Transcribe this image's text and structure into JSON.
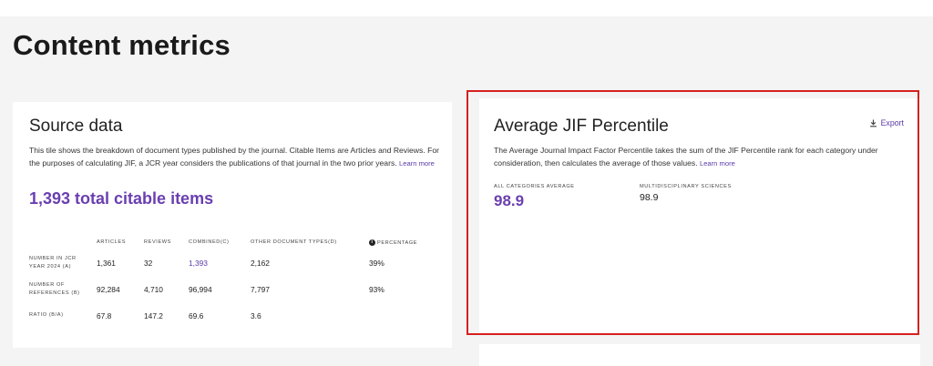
{
  "page": {
    "title": "Content metrics"
  },
  "source_data": {
    "title": "Source data",
    "description": "This tile shows the breakdown of document types published by the journal. Citable Items are Articles and Reviews. For the purposes of calculating JIF, a JCR year considers the publications of that journal in the two prior years.",
    "learn_more": "Learn more",
    "total_citable": "1,393 total citable items",
    "columns": [
      "ARTICLES",
      "REVIEWS",
      "COMBINED(C)",
      "OTHER DOCUMENT TYPES(D)",
      "PERCENTAGE"
    ],
    "percentage_info_icon": "info-icon",
    "rows": [
      {
        "label_line1": "NUMBER IN JCR",
        "label_line2": "YEAR 2024 (A)",
        "articles": "1,361",
        "reviews": "32",
        "combined": "1,393",
        "other": "2,162",
        "percentage": "39%"
      },
      {
        "label_line1": "NUMBER OF",
        "label_line2": "REFERENCES (B)",
        "articles": "92,284",
        "reviews": "4,710",
        "combined": "96,994",
        "other": "7,797",
        "percentage": "93%"
      },
      {
        "label_line1": "RATIO (B/A)",
        "label_line2": "",
        "articles": "67.8",
        "reviews": "147.2",
        "combined": "69.6",
        "other": "3.6",
        "percentage": ""
      }
    ]
  },
  "jif_percentile": {
    "title": "Average JIF Percentile",
    "export_label": "Export",
    "export_icon": "download-icon",
    "description": "The Average Journal Impact Factor Percentile takes the sum of the JIF Percentile rank for each category under consideration, then calculates the average of those values.",
    "learn_more": "Learn more",
    "all_categories_label": "ALL CATEGORIES AVERAGE",
    "all_categories_value": "98.9",
    "category_label": "MULTIDISCIPLINARY SCIENCES",
    "category_value": "98.9"
  },
  "colors": {
    "accent_purple": "#6a3fb0",
    "highlight_red": "#d62020",
    "background": "#f4f4f4"
  }
}
